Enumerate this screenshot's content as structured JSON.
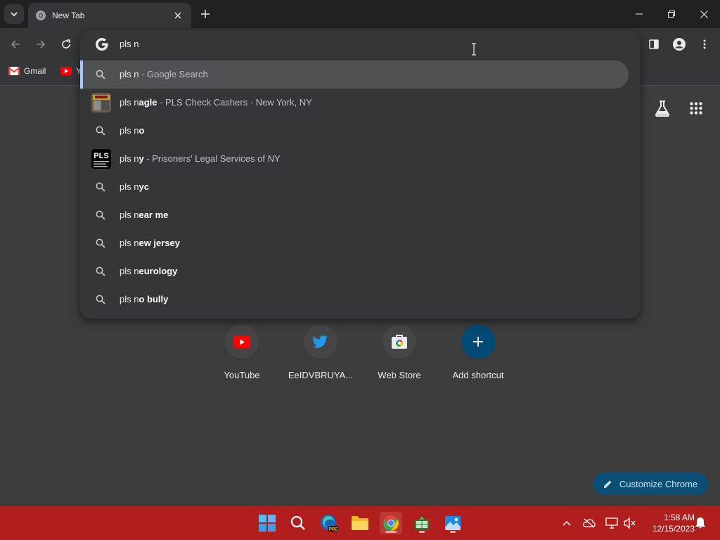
{
  "browser": {
    "tab_title": "New Tab",
    "bookmarks": [
      {
        "label": "Gmail",
        "icon": "gmail-icon"
      },
      {
        "label": "Y",
        "icon": "youtube-icon"
      }
    ]
  },
  "omnibox": {
    "query": "pls n",
    "suggestions": [
      {
        "type": "search",
        "icon": "search-icon",
        "typed": "pls n",
        "bold": "",
        "desc": " - Google Search",
        "selected": true
      },
      {
        "type": "entity",
        "icon": "thumbnail",
        "typed": "pls n",
        "bold": "agle",
        "desc": " - PLS Check Cashers · New York, NY"
      },
      {
        "type": "search",
        "icon": "search-icon",
        "typed": "pls n",
        "bold": "o",
        "desc": ""
      },
      {
        "type": "entity",
        "icon": "pls-logo",
        "typed": "pls n",
        "bold": "y",
        "desc": " - Prisoners' Legal Services of NY"
      },
      {
        "type": "search",
        "icon": "search-icon",
        "typed": "pls n",
        "bold": "yc",
        "desc": ""
      },
      {
        "type": "search",
        "icon": "search-icon",
        "typed": "pls n",
        "bold": "ear me",
        "desc": ""
      },
      {
        "type": "search",
        "icon": "search-icon",
        "typed": "pls n",
        "bold": "ew jersey",
        "desc": ""
      },
      {
        "type": "search",
        "icon": "search-icon",
        "typed": "pls n",
        "bold": "eurology",
        "desc": ""
      },
      {
        "type": "search",
        "icon": "search-icon",
        "typed": "pls n",
        "bold": "o bully",
        "desc": ""
      }
    ],
    "pls_logo_text": "PLS"
  },
  "shortcuts": [
    {
      "label": "YouTube",
      "icon": "youtube-icon"
    },
    {
      "label": "EeIDVBRUYA...",
      "icon": "twitter-icon"
    },
    {
      "label": "Web Store",
      "icon": "webstore-icon"
    },
    {
      "label": "Add shortcut",
      "icon": "plus-icon"
    }
  ],
  "customize_label": "Customize Chrome",
  "taskbar": {
    "time": "1:58 AM",
    "date": "12/15/2023",
    "edge_badge": "PRE"
  },
  "colors": {
    "accent": "#a8c7fa",
    "taskbar": "#b01e1e",
    "customize_bg": "#0b4f76"
  }
}
